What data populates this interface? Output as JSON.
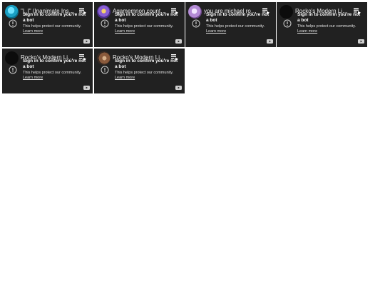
{
  "cards": [
    {
      "title": "\"I_I\" (Inanimate Insa...",
      "avatar": "teal",
      "message": "Sign in to confirm you're not a bot",
      "subtext": "This helps protect our community.",
      "learn_more": "Learn more"
    },
    {
      "title": "Agamemnon counte...",
      "avatar": "purple",
      "message": "Sign in to confirm you're not a bot",
      "subtext": "This helps protect our community.",
      "learn_more": "Learn more"
    },
    {
      "title": "you are michael rose...",
      "avatar": "pink",
      "message": "Sign in to confirm you're not a bot",
      "subtext": "This helps protect our community.",
      "learn_more": "Learn more"
    },
    {
      "title": "Rocko's Modern Life:...",
      "avatar": "black",
      "message": "Sign in to confirm you're not a bot",
      "subtext": "This helps protect our community.",
      "learn_more": "Learn more"
    },
    {
      "title": "Rocko's Modern Life:...",
      "avatar": "black",
      "message": "Sign in to confirm you're not a bot",
      "subtext": "This helps protect our community.",
      "learn_more": "Learn more"
    },
    {
      "title": "Rocko's Modern Life ...",
      "avatar": "brown",
      "message": "Sign in to confirm you're not a bot",
      "subtext": "This helps protect our community.",
      "learn_more": "Learn more"
    }
  ]
}
